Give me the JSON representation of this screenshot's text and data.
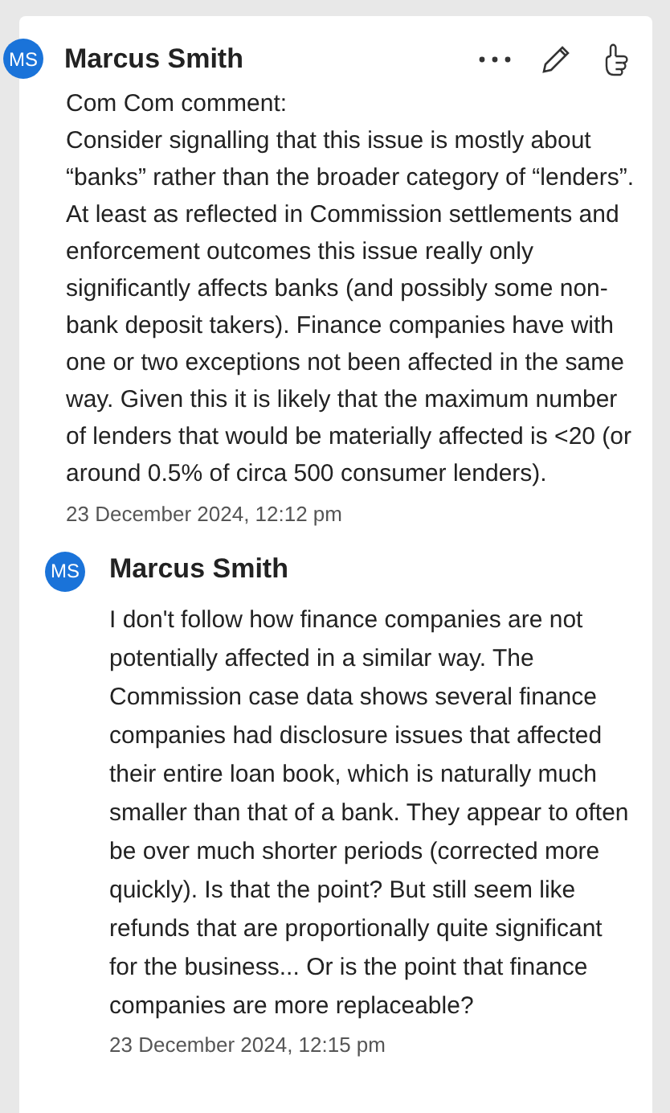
{
  "comment": {
    "avatar": "MS",
    "author": "Marcus Smith",
    "paragraphs": [
      "Com Com comment:",
      "Consider signalling that this issue is mostly about “banks” rather than the broader category of “lenders”. At least as reflected in Commission settlements and enforcement outcomes this issue really only significantly affects banks (and possibly some non-bank deposit takers). Finance companies have with one or two exceptions not been affected in the same way. Given this it is likely that the maximum number of lenders that would be materially affected is <20 (or around 0.5% of circa 500 consumer lenders)."
    ],
    "date": "23 December 2024, 12:12 pm"
  },
  "replies": [
    {
      "avatar": "MS",
      "author": "Marcus Smith",
      "text": "I don't follow how finance companies are not potentially affected in a similar way. The Commission case data shows several finance companies had disclosure issues that affected their entire loan book, which is naturally much smaller than that of a bank. They appear to often be over much shorter periods (corrected more quickly). Is that the point? But still seem like refunds that are proportionally quite significant for the business... Or is the point that finance companies are more replaceable?",
      "date": "23 December 2024, 12:15 pm"
    }
  ]
}
